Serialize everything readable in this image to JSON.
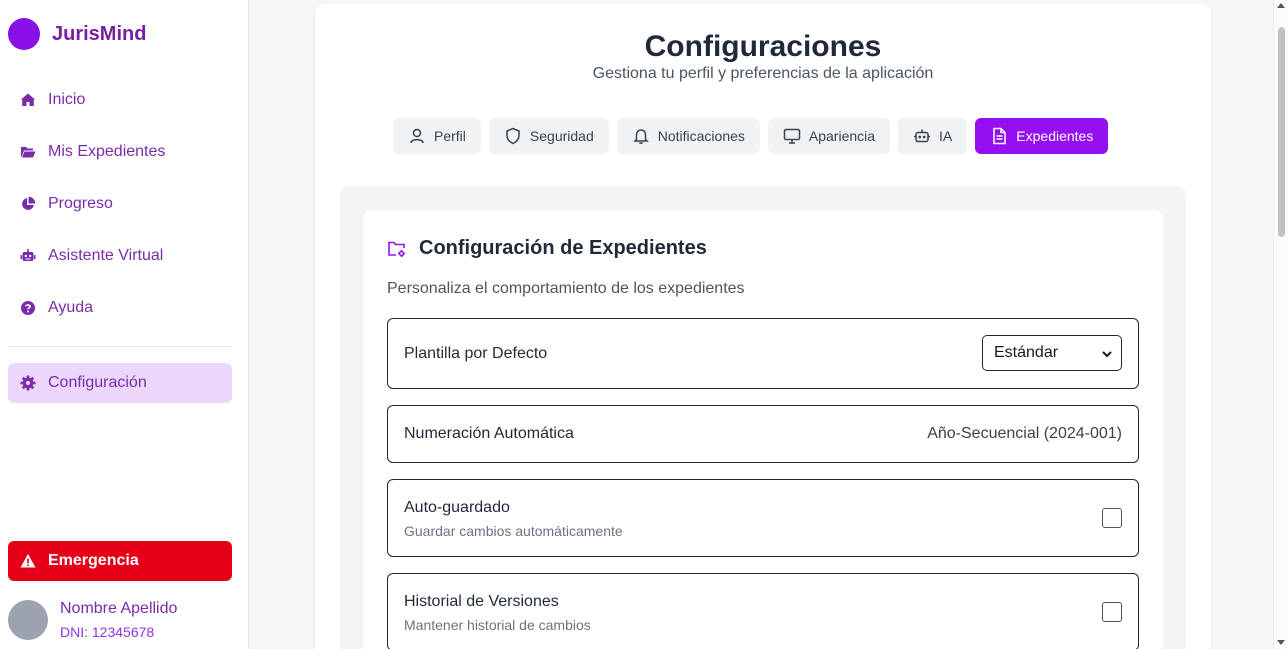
{
  "brand": {
    "name": "JurisMind"
  },
  "sidebar": {
    "items": [
      {
        "label": "Inicio",
        "icon": "home-icon"
      },
      {
        "label": "Mis Expedientes",
        "icon": "folder-open-icon"
      },
      {
        "label": "Progreso",
        "icon": "pie-chart-icon"
      },
      {
        "label": "Asistente Virtual",
        "icon": "robot-icon"
      },
      {
        "label": "Ayuda",
        "icon": "question-circle-icon"
      }
    ],
    "active": {
      "label": "Configuración",
      "icon": "gear-icon"
    },
    "emergency": {
      "label": "Emergencia",
      "icon": "warning-icon"
    },
    "user": {
      "name": "Nombre Apellido",
      "dni": "DNI: 12345678"
    }
  },
  "header": {
    "title": "Configuraciones",
    "subtitle": "Gestiona tu perfil y preferencias de la aplicación"
  },
  "tabs": [
    {
      "label": "Perfil",
      "icon": "user-icon",
      "active": false
    },
    {
      "label": "Seguridad",
      "icon": "shield-icon",
      "active": false
    },
    {
      "label": "Notificaciones",
      "icon": "bell-icon",
      "active": false
    },
    {
      "label": "Apariencia",
      "icon": "monitor-icon",
      "active": false
    },
    {
      "label": "IA",
      "icon": "bot-icon",
      "active": false
    },
    {
      "label": "Expedientes",
      "icon": "file-text-icon",
      "active": true
    }
  ],
  "section": {
    "title": "Configuración de Expedientes",
    "description": "Personaliza el comportamiento de los expedientes",
    "template": {
      "label": "Plantilla por Defecto",
      "value": "Estándar"
    },
    "numbering": {
      "label": "Numeración Automática",
      "value": "Año-Secuencial (2024-001)"
    },
    "autosave": {
      "label": "Auto-guardado",
      "help": "Guardar cambios automáticamente",
      "checked": false
    },
    "history": {
      "label": "Historial de Versiones",
      "help": "Mantener historial de cambios",
      "checked": false
    }
  },
  "colors": {
    "accent": "#9510f0",
    "brand": "#7b1fa2",
    "emergency": "#e40016",
    "active_bg": "#ead7fb"
  }
}
